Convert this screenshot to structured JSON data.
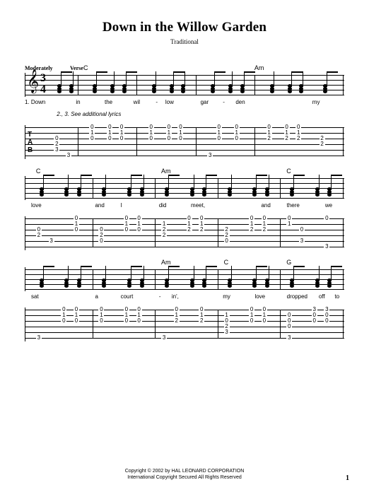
{
  "title": "Down in the Willow Garden",
  "composer": "Traditional",
  "tempo": "Moderately",
  "section": "Verse",
  "time_signature": {
    "top": "3",
    "bottom": "4"
  },
  "systems": [
    {
      "chords": [
        {
          "x": 12,
          "label": "C"
        },
        {
          "x": 70,
          "label": "Am"
        }
      ],
      "lyrics": [
        {
          "x": 0,
          "text": "1. Down"
        },
        {
          "x": 16,
          "text": "in"
        },
        {
          "x": 25,
          "text": "the"
        },
        {
          "x": 34,
          "text": "wil"
        },
        {
          "x": 41,
          "text": "-"
        },
        {
          "x": 44,
          "text": "low"
        },
        {
          "x": 55,
          "text": "gar"
        },
        {
          "x": 62,
          "text": "-"
        },
        {
          "x": 66,
          "text": "den"
        },
        {
          "x": 90,
          "text": "my"
        }
      ],
      "lyrics2": {
        "x": 10,
        "text": "2., 3. See additional lyrics"
      },
      "bars": [
        10,
        30,
        50,
        70,
        100
      ],
      "notechunks": [
        2,
        6,
        14,
        20,
        24,
        34,
        40,
        44,
        54,
        60,
        64,
        74,
        80,
        84,
        92
      ],
      "tab_columns": [
        {
          "x": 2,
          "frets": [
            null,
            null,
            "0",
            "2",
            "3",
            null
          ]
        },
        {
          "x": 6,
          "frets": [
            null,
            null,
            null,
            null,
            null,
            "3"
          ]
        },
        {
          "x": 14,
          "frets": [
            "0",
            "1",
            "0",
            null,
            null,
            null
          ]
        },
        {
          "x": 20,
          "frets": [
            "0",
            "1",
            "0",
            null,
            null,
            null
          ]
        },
        {
          "x": 24,
          "frets": [
            "0",
            "1",
            "0",
            null,
            null,
            null
          ]
        },
        {
          "x": 34,
          "frets": [
            "0",
            "1",
            "0",
            null,
            null,
            null
          ]
        },
        {
          "x": 40,
          "frets": [
            "0",
            "1",
            "0",
            null,
            null,
            null
          ]
        },
        {
          "x": 44,
          "frets": [
            "0",
            "1",
            "0",
            null,
            null,
            null
          ]
        },
        {
          "x": 54,
          "frets": [
            null,
            null,
            null,
            null,
            null,
            "3"
          ]
        },
        {
          "x": 57,
          "frets": [
            "0",
            "1",
            "0",
            null,
            null,
            null
          ]
        },
        {
          "x": 63,
          "frets": [
            "0",
            "1",
            "0",
            null,
            null,
            null
          ]
        },
        {
          "x": 74,
          "frets": [
            "0",
            "1",
            "2",
            null,
            null,
            null
          ]
        },
        {
          "x": 80,
          "frets": [
            "0",
            "1",
            "2",
            null,
            null,
            null
          ]
        },
        {
          "x": 84,
          "frets": [
            "0",
            "1",
            "2",
            null,
            null,
            null
          ]
        },
        {
          "x": 92,
          "frets": [
            null,
            null,
            "2",
            "2",
            null,
            null
          ]
        }
      ]
    },
    {
      "chords": [
        {
          "x": 2,
          "label": "C"
        },
        {
          "x": 42,
          "label": "Am"
        },
        {
          "x": 82,
          "label": "C"
        }
      ],
      "lyrics": [
        {
          "x": 2,
          "text": "love"
        },
        {
          "x": 22,
          "text": "and"
        },
        {
          "x": 30,
          "text": "I"
        },
        {
          "x": 42,
          "text": "did"
        },
        {
          "x": 52,
          "text": "meet,"
        },
        {
          "x": 74,
          "text": "and"
        },
        {
          "x": 82,
          "text": "there"
        },
        {
          "x": 94,
          "text": "we"
        }
      ],
      "bars": [
        20,
        40,
        60,
        80,
        100
      ],
      "notechunks": [
        2,
        10,
        14,
        22,
        30,
        34,
        42,
        50,
        54,
        62,
        70,
        74,
        82,
        90,
        94
      ],
      "tab_columns": [
        {
          "x": 2,
          "frets": [
            null,
            null,
            "0",
            "2",
            null,
            null
          ]
        },
        {
          "x": 6,
          "frets": [
            null,
            null,
            null,
            null,
            "3",
            null
          ]
        },
        {
          "x": 14,
          "frets": [
            "0",
            "1",
            "0",
            null,
            null,
            null
          ]
        },
        {
          "x": 22,
          "frets": [
            null,
            null,
            "0",
            "2",
            "0",
            null
          ]
        },
        {
          "x": 30,
          "frets": [
            "0",
            "1",
            "0",
            null,
            null,
            null
          ]
        },
        {
          "x": 34,
          "frets": [
            "0",
            "1",
            "0",
            null,
            null,
            null
          ]
        },
        {
          "x": 42,
          "frets": [
            null,
            "1",
            "2",
            "2",
            null,
            null
          ]
        },
        {
          "x": 50,
          "frets": [
            "0",
            "1",
            "2",
            null,
            null,
            null
          ]
        },
        {
          "x": 54,
          "frets": [
            "0",
            "1",
            "2",
            null,
            null,
            null
          ]
        },
        {
          "x": 62,
          "frets": [
            null,
            null,
            "2",
            "2",
            "0",
            null
          ]
        },
        {
          "x": 70,
          "frets": [
            "0",
            "1",
            "2",
            null,
            null,
            null
          ]
        },
        {
          "x": 74,
          "frets": [
            "0",
            "1",
            "2",
            null,
            null,
            null
          ]
        },
        {
          "x": 82,
          "frets": [
            "0",
            "1",
            null,
            null,
            null,
            null
          ]
        },
        {
          "x": 86,
          "frets": [
            null,
            null,
            "0",
            null,
            "3",
            null
          ]
        },
        {
          "x": 94,
          "frets": [
            "0",
            null,
            null,
            null,
            null,
            "3"
          ]
        }
      ]
    },
    {
      "chords": [
        {
          "x": 42,
          "label": "Am"
        },
        {
          "x": 62,
          "label": "C"
        },
        {
          "x": 82,
          "label": "G"
        }
      ],
      "lyrics": [
        {
          "x": 2,
          "text": "sat"
        },
        {
          "x": 22,
          "text": "a"
        },
        {
          "x": 30,
          "text": "court"
        },
        {
          "x": 42,
          "text": "-"
        },
        {
          "x": 46,
          "text": "in',"
        },
        {
          "x": 62,
          "text": "my"
        },
        {
          "x": 72,
          "text": "love"
        },
        {
          "x": 82,
          "text": "dropped"
        },
        {
          "x": 92,
          "text": "off"
        },
        {
          "x": 97,
          "text": "to"
        }
      ],
      "bars": [
        20,
        40,
        60,
        80,
        100
      ],
      "notechunks": [
        2,
        10,
        14,
        22,
        30,
        34,
        42,
        50,
        54,
        62,
        70,
        74,
        82,
        90,
        94
      ],
      "tab_columns": [
        {
          "x": 2,
          "frets": [
            null,
            null,
            null,
            null,
            null,
            "3"
          ]
        },
        {
          "x": 10,
          "frets": [
            "0",
            "1",
            "0",
            null,
            null,
            null
          ]
        },
        {
          "x": 14,
          "frets": [
            "0",
            "1",
            "0",
            null,
            null,
            null
          ]
        },
        {
          "x": 22,
          "frets": [
            "0",
            "1",
            "0",
            null,
            null,
            null
          ]
        },
        {
          "x": 30,
          "frets": [
            "0",
            "1",
            "0",
            null,
            null,
            null
          ]
        },
        {
          "x": 34,
          "frets": [
            "0",
            "1",
            "0",
            null,
            null,
            null
          ]
        },
        {
          "x": 42,
          "frets": [
            null,
            null,
            null,
            null,
            null,
            "3"
          ]
        },
        {
          "x": 46,
          "frets": [
            "0",
            "1",
            "2",
            null,
            null,
            null
          ]
        },
        {
          "x": 54,
          "frets": [
            "0",
            "1",
            "2",
            null,
            null,
            null
          ]
        },
        {
          "x": 62,
          "frets": [
            null,
            "1",
            "0",
            "2",
            "3",
            null
          ]
        },
        {
          "x": 70,
          "frets": [
            "0",
            "1",
            "0",
            null,
            null,
            null
          ]
        },
        {
          "x": 74,
          "frets": [
            "0",
            "1",
            "0",
            null,
            null,
            null
          ]
        },
        {
          "x": 82,
          "frets": [
            null,
            "0",
            "0",
            "0",
            null,
            "3"
          ]
        },
        {
          "x": 90,
          "frets": [
            "3",
            "0",
            "0",
            null,
            null,
            null
          ]
        },
        {
          "x": 94,
          "frets": [
            "3",
            "0",
            "0",
            null,
            null,
            null
          ]
        }
      ]
    }
  ],
  "copyright_line1": "Copyright © 2002 by HAL LEONARD CORPORATION",
  "copyright_line2": "International Copyright Secured   All Rights Reserved",
  "page_number": "1"
}
